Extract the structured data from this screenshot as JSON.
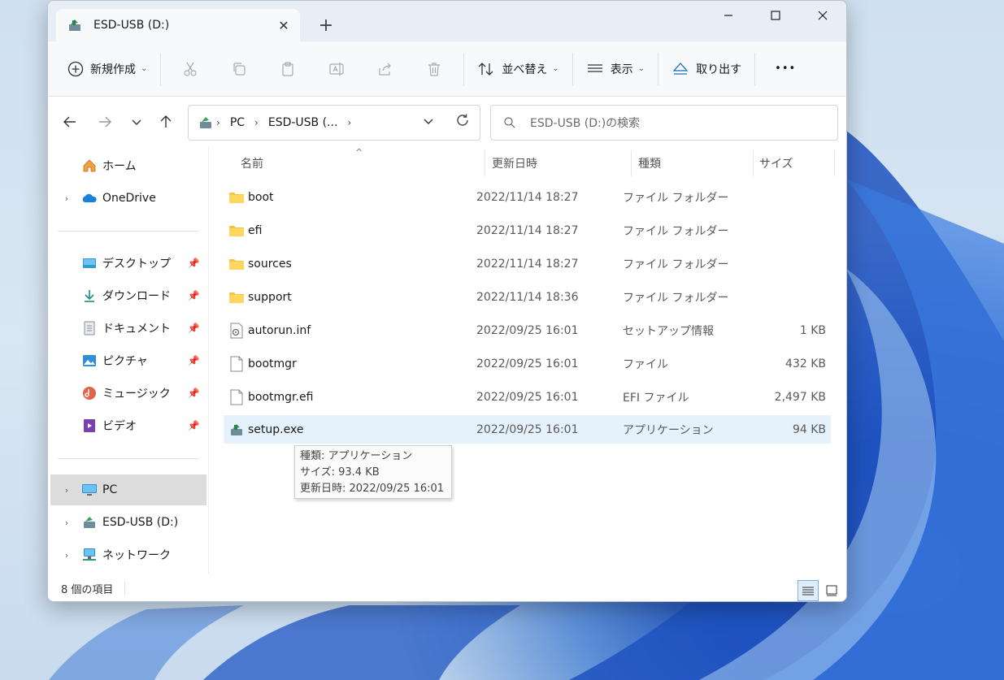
{
  "window": {
    "tab_title": "ESD-USB (D:)",
    "tab_close": "✕",
    "new_tab": "+",
    "minimize": "—",
    "maximize": "☐",
    "close": "✕"
  },
  "toolbar": {
    "new_label": "新規作成",
    "sort_label": "並べ替え",
    "view_label": "表示",
    "eject_label": "取り出す",
    "more_label": "•••",
    "caret": "⌄"
  },
  "nav": {
    "breadcrumb": [
      "PC",
      "ESD-USB (..."
    ],
    "search_placeholder": "ESD-USB (D:)の検索"
  },
  "sidebar": {
    "items": [
      {
        "label": "ホーム",
        "icon": "home-icon"
      },
      {
        "label": "OneDrive",
        "icon": "onedrive-icon"
      },
      {
        "label": "デスクトップ",
        "icon": "desktop-icon"
      },
      {
        "label": "ダウンロード",
        "icon": "download-icon"
      },
      {
        "label": "ドキュメント",
        "icon": "document-icon"
      },
      {
        "label": "ピクチャ",
        "icon": "pictures-icon"
      },
      {
        "label": "ミュージック",
        "icon": "music-icon"
      },
      {
        "label": "ビデオ",
        "icon": "video-icon"
      },
      {
        "label": "PC",
        "icon": "pc-icon"
      },
      {
        "label": "ESD-USB (D:)",
        "icon": "usb-drive-icon"
      },
      {
        "label": "ネットワーク",
        "icon": "network-icon"
      }
    ]
  },
  "columns": {
    "name": "名前",
    "date": "更新日時",
    "type": "種類",
    "size": "サイズ"
  },
  "files": [
    {
      "name": "boot",
      "date": "2022/11/14 18:27",
      "type": "ファイル フォルダー",
      "size": "",
      "icon": "folder-icon"
    },
    {
      "name": "efi",
      "date": "2022/11/14 18:27",
      "type": "ファイル フォルダー",
      "size": "",
      "icon": "folder-icon"
    },
    {
      "name": "sources",
      "date": "2022/11/14 18:27",
      "type": "ファイル フォルダー",
      "size": "",
      "icon": "folder-icon"
    },
    {
      "name": "support",
      "date": "2022/11/14 18:36",
      "type": "ファイル フォルダー",
      "size": "",
      "icon": "folder-icon"
    },
    {
      "name": "autorun.inf",
      "date": "2022/09/25 16:01",
      "type": "セットアップ情報",
      "size": "1 KB",
      "icon": "setup-info-icon"
    },
    {
      "name": "bootmgr",
      "date": "2022/09/25 16:01",
      "type": "ファイル",
      "size": "432 KB",
      "icon": "file-icon"
    },
    {
      "name": "bootmgr.efi",
      "date": "2022/09/25 16:01",
      "type": "EFI ファイル",
      "size": "2,497 KB",
      "icon": "file-icon"
    },
    {
      "name": "setup.exe",
      "date": "2022/09/25 16:01",
      "type": "アプリケーション",
      "size": "94 KB",
      "icon": "setup-exe-icon"
    }
  ],
  "tooltip": {
    "line1": "種類: アプリケーション",
    "line2": "サイズ: 93.4 KB",
    "line3": "更新日時: 2022/09/25 16:01"
  },
  "status": {
    "item_count": "8 個の項目"
  },
  "colors": {
    "accent": "#0067c0",
    "folder": "#f4c24a",
    "hover_row": "#e5f1fb",
    "selected_nav": "#dcdcdc"
  }
}
